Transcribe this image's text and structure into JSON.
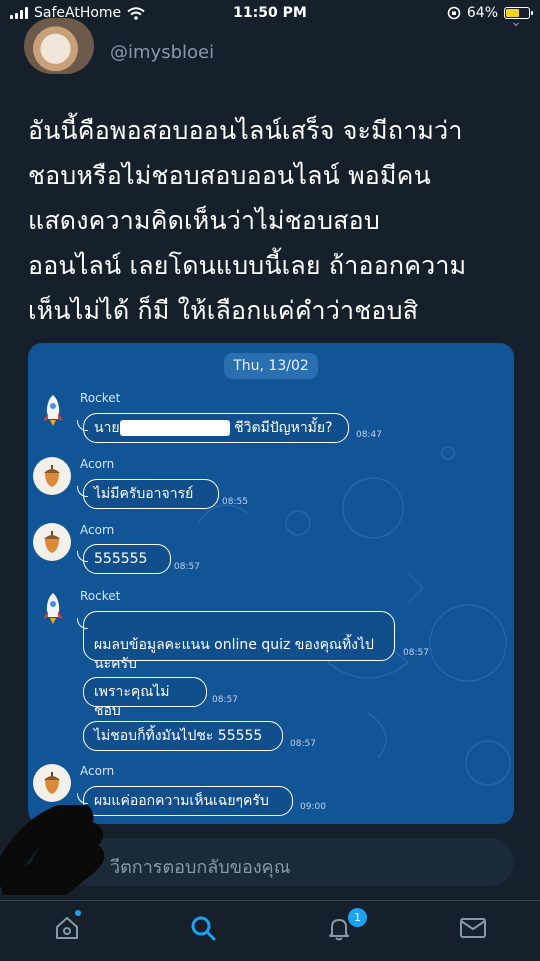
{
  "status_bar": {
    "carrier": "SafeAtHome",
    "time": "11:50 PM",
    "battery": "64%",
    "battery_level": 0.64,
    "battery_color": "#f5d31a"
  },
  "tweet": {
    "username": "@imysbloei",
    "text": "อันนี้คือพอสอบออนไลน์เสร็จ จะมีถามว่า\nชอบหรือไม่ชอบสอบออนไลน์ พอมีคน\nแสดงความคิดเห็นว่าไม่ชอบสอบ\nออนไลน์ เลยโดนแบบนี้เลย ถ้าออกความ\nเห็นไม่ได้ ก็มี ให้เลือกแค่คำว่าชอบสิ"
  },
  "chat": {
    "date": "Thu, 13/02",
    "messages": [
      {
        "sender": "Rocket",
        "text_before": "นาย",
        "text_after": " ชีวิตมีปัญหามั้ย?",
        "time": "08:47"
      },
      {
        "sender": "Acorn",
        "text": "ไม่มีครับอาจารย์",
        "time": "08:55"
      },
      {
        "sender": "Acorn",
        "text": "555555",
        "time": "08:57"
      },
      {
        "sender": "Rocket",
        "text": "ผมลบข้อมูลคะแนน online quiz ของคุณทิ้งไป\nนะครับ",
        "time": "08:57"
      },
      {
        "sender": "",
        "text": "เพราะคุณไม่ชอบ",
        "time": "08:57"
      },
      {
        "sender": "",
        "text": "ไม่ชอบก็ทิ้งมันไปชะ 55555",
        "time": "08:57"
      },
      {
        "sender": "Acorn",
        "text": "ผมแค่ออกความเห็นเฉยๆครับ",
        "time": "09:00"
      }
    ]
  },
  "reply_placeholder": "วีตการตอบกลับของคุณ",
  "tabbar": {
    "notifications_badge": "1",
    "accent_color": "#1da1f2",
    "icons": [
      "home-icon",
      "search-icon",
      "bell-icon",
      "mail-icon"
    ]
  }
}
